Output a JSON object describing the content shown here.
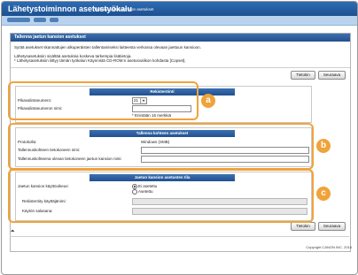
{
  "header": {
    "title": "Lähetystoiminnon asetustyökalu",
    "subtitle": "Tallenna jaetun kansion asetukset"
  },
  "panel": {
    "title": "Tallenna jaetun kansion asetukset",
    "description": [
      "Syötä asetukset skannattujen alkuperäisten tallentamiseksi laitteesta verkossa olevaan jaettuun kansioon.",
      "Lähetysasetuksiin sisältää asetuksia koskeva tarkempia lisätietoja.",
      "* Lähetysasetuksiin liittyy tämän työkalun Käynnistä CD-ROM:n asetusvalikon kohdasta [Copset]."
    ],
    "next_label": "Tietokin",
    "cancel_label": "Seuraava"
  },
  "registration": {
    "title": "Rekisteröinti",
    "speed_dial_label": "Pikavalintanumero:",
    "speed_dial_value": "21",
    "name_label": "Pikavalintanumeron nimi:",
    "name_value": "",
    "name_hint": "* Enintään 16 merkkiä"
  },
  "destination": {
    "title": "Tallenna kohteen asetukset",
    "protocol_label": "Protokolla:",
    "protocol_value": "Windows (SMB)",
    "host_label": "Tallennuskohteen tietokoneen nimi:",
    "path_label": "Tallennuskohteena olevan tietokoneen jaetun kansion nimi:"
  },
  "folder_state": {
    "title": "Jaetun kansion asetusten tila",
    "usage_label": "Jaetun kansion käyttöoikeus:",
    "option_off": "Ei asetettu",
    "option_on": "Asetettu",
    "user_label": "Rekisteröity käyttäjänimi:",
    "password_label": "Käytön salasana:"
  },
  "footer": {
    "next_label": "Tietokin",
    "cancel_label": "Seuraava",
    "copyright": "Copyright CANON INC. 2016"
  },
  "callouts": [
    "a",
    "b",
    "c"
  ],
  "colors": {
    "header": "#1d4f8f",
    "accent": "#f0a33a",
    "section_title": "#2a5a9a"
  }
}
